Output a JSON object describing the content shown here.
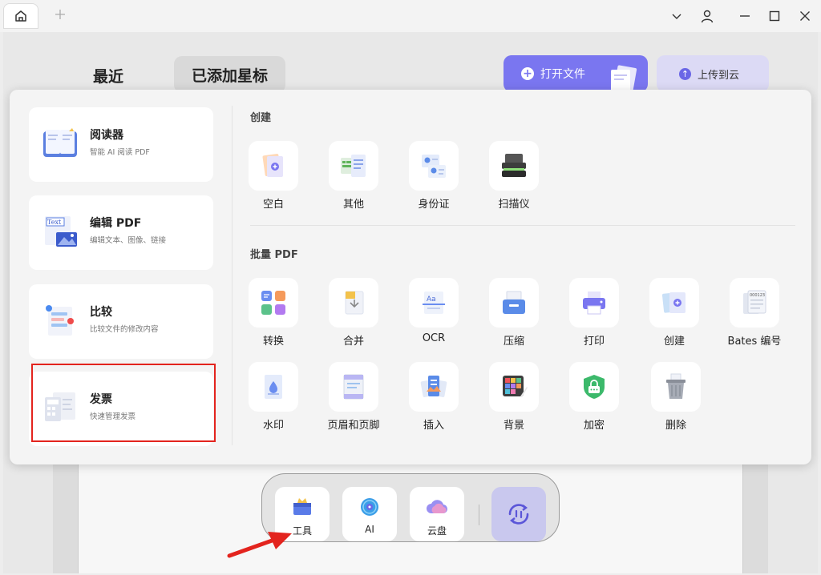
{
  "window": {
    "home_tab_icon": "home-icon",
    "new_tab_icon": "plus-icon",
    "controls": [
      "chevron-down-icon",
      "user-icon",
      "minimize-icon",
      "maximize-icon",
      "close-icon"
    ]
  },
  "home": {
    "tabs": [
      {
        "label": "最近"
      },
      {
        "label": "已添加星标"
      }
    ],
    "open_file_label": "打开文件",
    "upload_cloud_label": "上传到云"
  },
  "panel": {
    "cards": [
      {
        "title": "阅读器",
        "subtitle": "智能 AI 阅读 PDF"
      },
      {
        "title": "编辑 PDF",
        "subtitle": "编辑文本、图像、链接"
      },
      {
        "title": "比较",
        "subtitle": "比较文件的修改内容"
      },
      {
        "title": "发票",
        "subtitle": "快速管理发票"
      }
    ],
    "edit_icon_text": "Text",
    "sections": {
      "create": {
        "title": "创建",
        "items": [
          {
            "label": "空白",
            "icon": "blank-doc-icon"
          },
          {
            "label": "其他",
            "icon": "other-doc-icon"
          },
          {
            "label": "身份证",
            "icon": "id-card-icon"
          },
          {
            "label": "扫描仪",
            "icon": "scanner-icon"
          }
        ]
      },
      "batch": {
        "title": "批量 PDF",
        "items": [
          {
            "label": "转换",
            "icon": "convert-icon"
          },
          {
            "label": "合并",
            "icon": "merge-icon"
          },
          {
            "label": "OCR",
            "icon": "ocr-icon"
          },
          {
            "label": "压缩",
            "icon": "compress-icon"
          },
          {
            "label": "打印",
            "icon": "print-icon"
          },
          {
            "label": "创建",
            "icon": "create-icon"
          },
          {
            "label": "Bates 编号",
            "icon": "bates-icon"
          },
          {
            "label": "水印",
            "icon": "watermark-icon"
          },
          {
            "label": "页眉和页脚",
            "icon": "header-footer-icon"
          },
          {
            "label": "插入",
            "icon": "insert-icon"
          },
          {
            "label": "背景",
            "icon": "background-icon"
          },
          {
            "label": "加密",
            "icon": "encrypt-icon"
          },
          {
            "label": "删除",
            "icon": "delete-icon"
          }
        ]
      }
    },
    "ocr_icon_text": "Aa",
    "bates_icon_text": "000123"
  },
  "dock": {
    "items": [
      {
        "label": "工具",
        "icon": "toolbox-icon"
      },
      {
        "label": "AI",
        "icon": "ai-icon"
      },
      {
        "label": "云盘",
        "icon": "cloud-icon"
      }
    ],
    "sync_icon": "sync-icon"
  },
  "colors": {
    "accent": "#7a76f0",
    "highlight": "#e3241e",
    "arrow": "#e3241e"
  }
}
